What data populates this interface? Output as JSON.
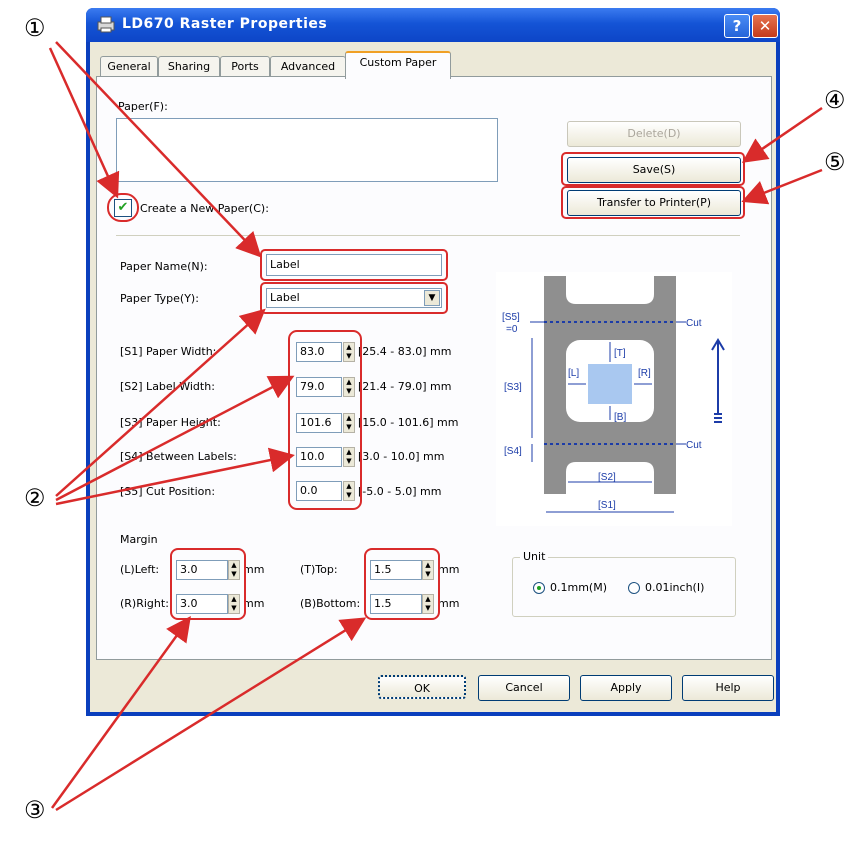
{
  "window": {
    "title": "LD670 Raster Properties",
    "help_glyph": "?",
    "close_glyph": "✕"
  },
  "tabs": [
    "General",
    "Sharing",
    "Ports",
    "Advanced",
    "Custom Paper"
  ],
  "active_tab": "Custom Paper",
  "paper_section": {
    "label": "Paper(F):",
    "delete_label": "Delete(D)",
    "save_label": "Save(S)",
    "transfer_label": "Transfer to Printer(P)",
    "create_new_label": "Create a New Paper(C):",
    "create_new_checked": true
  },
  "fields": {
    "paper_name_label": "Paper Name(N):",
    "paper_name_value": "Label",
    "paper_type_label": "Paper Type(Y):",
    "paper_type_value": "Label",
    "s1_label": "[S1] Paper Width:",
    "s1_value": "83.0",
    "s1_range": "[25.4 - 83.0] mm",
    "s2_label": "[S2] Label Width:",
    "s2_value": "79.0",
    "s2_range": "[21.4 - 79.0] mm",
    "s3_label": "[S3] Paper Height:",
    "s3_value": "101.6",
    "s3_range": "[15.0 - 101.6] mm",
    "s4_label": "[S4] Between Labels:",
    "s4_value": "10.0",
    "s4_range": "[3.0 - 10.0] mm",
    "s5_label": "[S5] Cut Position:",
    "s5_value": "0.0",
    "s5_range": "[-5.0 - 5.0] mm"
  },
  "margin": {
    "title": "Margin",
    "left_label": "(L)Left:",
    "left_value": "3.0",
    "right_label": "(R)Right:",
    "right_value": "3.0",
    "top_label": "(T)Top:",
    "top_value": "1.5",
    "bottom_label": "(B)Bottom:",
    "bottom_value": "1.5",
    "unit": "mm"
  },
  "diagram": {
    "s5": "[S5]",
    "s5_eq": "=0",
    "s3": "[S3]",
    "s4": "[S4]",
    "l": "[L]",
    "r": "[R]",
    "t": "[T]",
    "b": "[B]",
    "s2": "[S2]",
    "s1": "[S1]",
    "cut1": "Cut",
    "cut2": "Cut"
  },
  "unit": {
    "title": "Unit",
    "option_mm": "0.1mm(M)",
    "option_inch": "0.01inch(I)",
    "selected": "0.1mm(M)"
  },
  "footer": {
    "ok": "OK",
    "cancel": "Cancel",
    "apply": "Apply",
    "help": "Help"
  },
  "callouts": [
    "①",
    "②",
    "③",
    "④",
    "⑤"
  ],
  "colors": {
    "titlebar": "#1454d6",
    "highlight_red": "#d92b2b",
    "diagram_blue": "#1c3ca8",
    "label_blue": "#a9c8f0"
  }
}
